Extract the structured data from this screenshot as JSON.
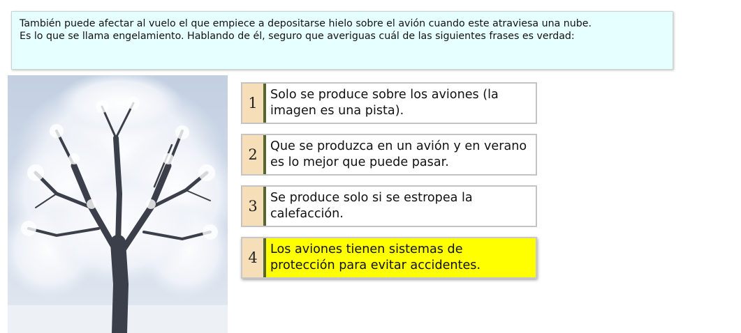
{
  "question": {
    "line1": "También puede afectar al vuelo el que empiece a depositarse hielo sobre el avión cuando este atraviesa una nube.",
    "line2": "Es lo que se llama engelamiento. Hablando de él, seguro que averiguas cuál de las siguientes frases es verdad:"
  },
  "image": {
    "subject": "frost-covered-tree-photo"
  },
  "options": [
    {
      "number": "1",
      "text": "Solo se produce sobre los aviones (la imagen es una pista).",
      "selected": false
    },
    {
      "number": "2",
      "text": "Que se produzca en un avión y en verano es lo mejor que puede pasar.",
      "selected": false
    },
    {
      "number": "3",
      "text": "Se produce solo si se estropea la calefacción.",
      "selected": false
    },
    {
      "number": "4",
      "text": "Los aviones tienen sistemas de protección para evitar accidentes.",
      "selected": true
    }
  ],
  "colors": {
    "question_bg": "#e6ffff",
    "number_bg": "#f5deb8",
    "number_bar": "#55662f",
    "selected_bg": "#ffff00"
  }
}
